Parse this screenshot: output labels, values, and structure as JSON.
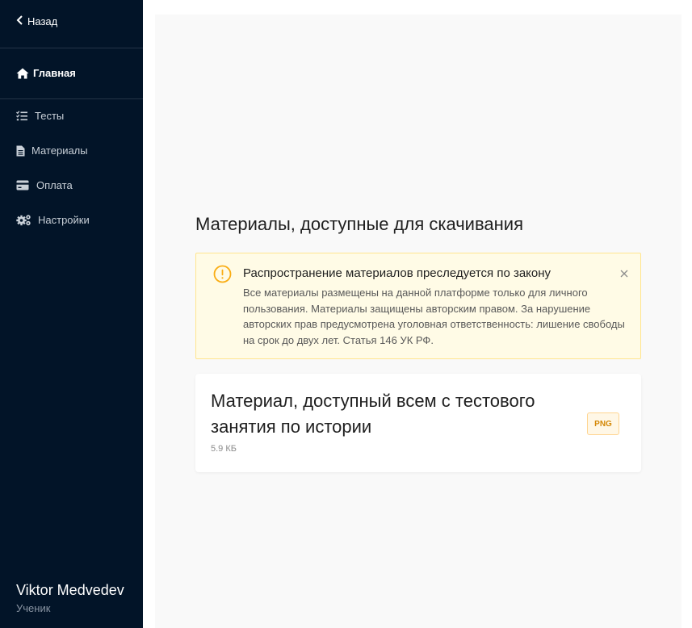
{
  "sidebar": {
    "back_label": "Назад",
    "home_label": "Главная",
    "items": [
      {
        "label": "Тесты",
        "icon": "tasks-icon"
      },
      {
        "label": "Материалы",
        "icon": "file-icon"
      },
      {
        "label": "Оплата",
        "icon": "credit-card-icon"
      },
      {
        "label": "Настройки",
        "icon": "cogs-icon"
      }
    ],
    "user": {
      "name": "Viktor Medvedev",
      "role": "Ученик"
    }
  },
  "main": {
    "title": "Материалы, доступные для скачивания",
    "alert": {
      "title": "Распространение материалов преследуется по закону",
      "text": "Все материалы размещены на данной платформе только для личного пользования. Материалы защищены авторским правом. За нарушение авторских прав предусмотрена уголовная ответственность: лишение свободы на срок до двух лет. Статья 146 УК РФ.",
      "icon": "exclamation-circle-icon"
    },
    "materials": [
      {
        "title": "Материал, доступный всем с тестового занятия по истории",
        "size": "5.9 КБ",
        "type": "PNG"
      }
    ]
  },
  "colors": {
    "sidebar_bg": "#021428",
    "content_bg": "#f9f9f9",
    "alert_bg": "#fffbe6",
    "alert_border": "#ffe58f",
    "warning": "#faad14",
    "badge_text": "#d48806"
  }
}
